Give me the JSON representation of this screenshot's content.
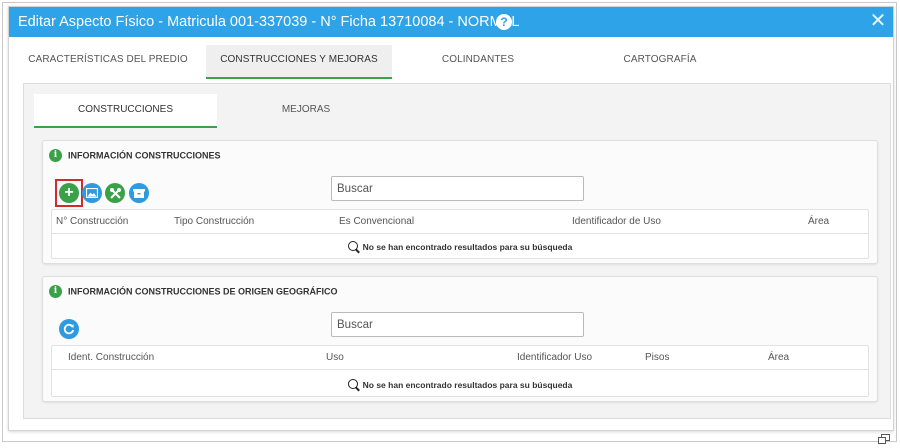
{
  "modal": {
    "title": "Editar Aspecto Físico - Matricula 001-337039 - N° Ficha 13710084 - NORMAL",
    "help_glyph": "?",
    "close_glyph": "✕"
  },
  "main_tabs": [
    {
      "label": "CARACTERÍSTICAS DEL PREDIO"
    },
    {
      "label": "CONSTRUCCIONES Y MEJORAS",
      "active": true
    },
    {
      "label": "COLINDANTES"
    },
    {
      "label": "CARTOGRAFÍA"
    }
  ],
  "sub_tabs": [
    {
      "label": "CONSTRUCCIONES",
      "active": true
    },
    {
      "label": "MEJORAS"
    }
  ],
  "section_constructions": {
    "title": "INFORMACIÓN CONSTRUCCIONES",
    "search_placeholder": "Buscar",
    "columns": [
      "N° Construcción",
      "Tipo Construcción",
      "Es Convencional",
      "Identificador de Uso",
      "Área"
    ],
    "empty_message": "No se han encontrado resultados para su búsqueda",
    "toolbar_icons": [
      "add-icon",
      "image-icon",
      "tools-icon",
      "box-icon"
    ]
  },
  "section_geo": {
    "title": "INFORMACIÓN CONSTRUCCIONES DE ORIGEN GEOGRÁFICO",
    "search_placeholder": "Buscar",
    "columns": [
      "Ident. Construcción",
      "Uso",
      "Identificador Uso",
      "Pisos",
      "Área"
    ],
    "empty_message": "No se han encontrado resultados para su búsqueda",
    "toolbar_icons": [
      "refresh-icon"
    ]
  },
  "colors": {
    "titlebar": "#2ea3e8",
    "accent_green": "#3ba148",
    "accent_blue": "#2e9ae0",
    "highlight_red": "#d12b2b"
  }
}
